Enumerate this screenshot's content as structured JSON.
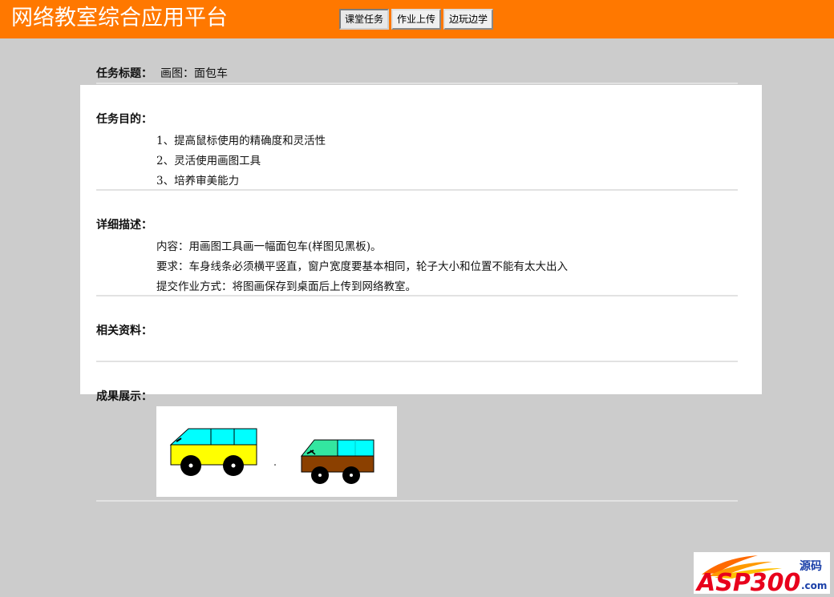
{
  "header": {
    "app_title": "网络教室综合应用平台",
    "nav": [
      {
        "label": "课堂任务",
        "active": true
      },
      {
        "label": "作业上传",
        "active": false
      },
      {
        "label": "边玩边学",
        "active": false
      }
    ]
  },
  "task": {
    "title_label": "任务标题：",
    "title_value": "画图：面包车",
    "purpose_label": "任务目的：",
    "purpose_items": [
      "1、提高鼠标使用的精确度和灵活性",
      "2、灵活使用画图工具",
      "3、培养审美能力"
    ],
    "detail_label": "详细描述：",
    "detail_items": [
      "内容：用画图工具画一幅面包车(样图见黑板)。",
      "要求：车身线条必须横平竖直，窗户宽度要基本相同，轮子大小和位置不能有太大出入",
      "提交作业方式：将图画保存到桌面后上传到网络教室。"
    ],
    "materials_label": "相关资料：",
    "results_label": "成果展示："
  },
  "watermark": {
    "brand": "ASP300",
    "suffix": "源码",
    "domain": ".com"
  },
  "colors": {
    "header": "#ff7800",
    "page_bg": "#cccccc",
    "van1_body": "#ffff00",
    "van1_window": "#00ffff",
    "van2_body": "#8b4000",
    "van2_window": "#00ffff",
    "van2_window_front": "#33e6a0"
  }
}
